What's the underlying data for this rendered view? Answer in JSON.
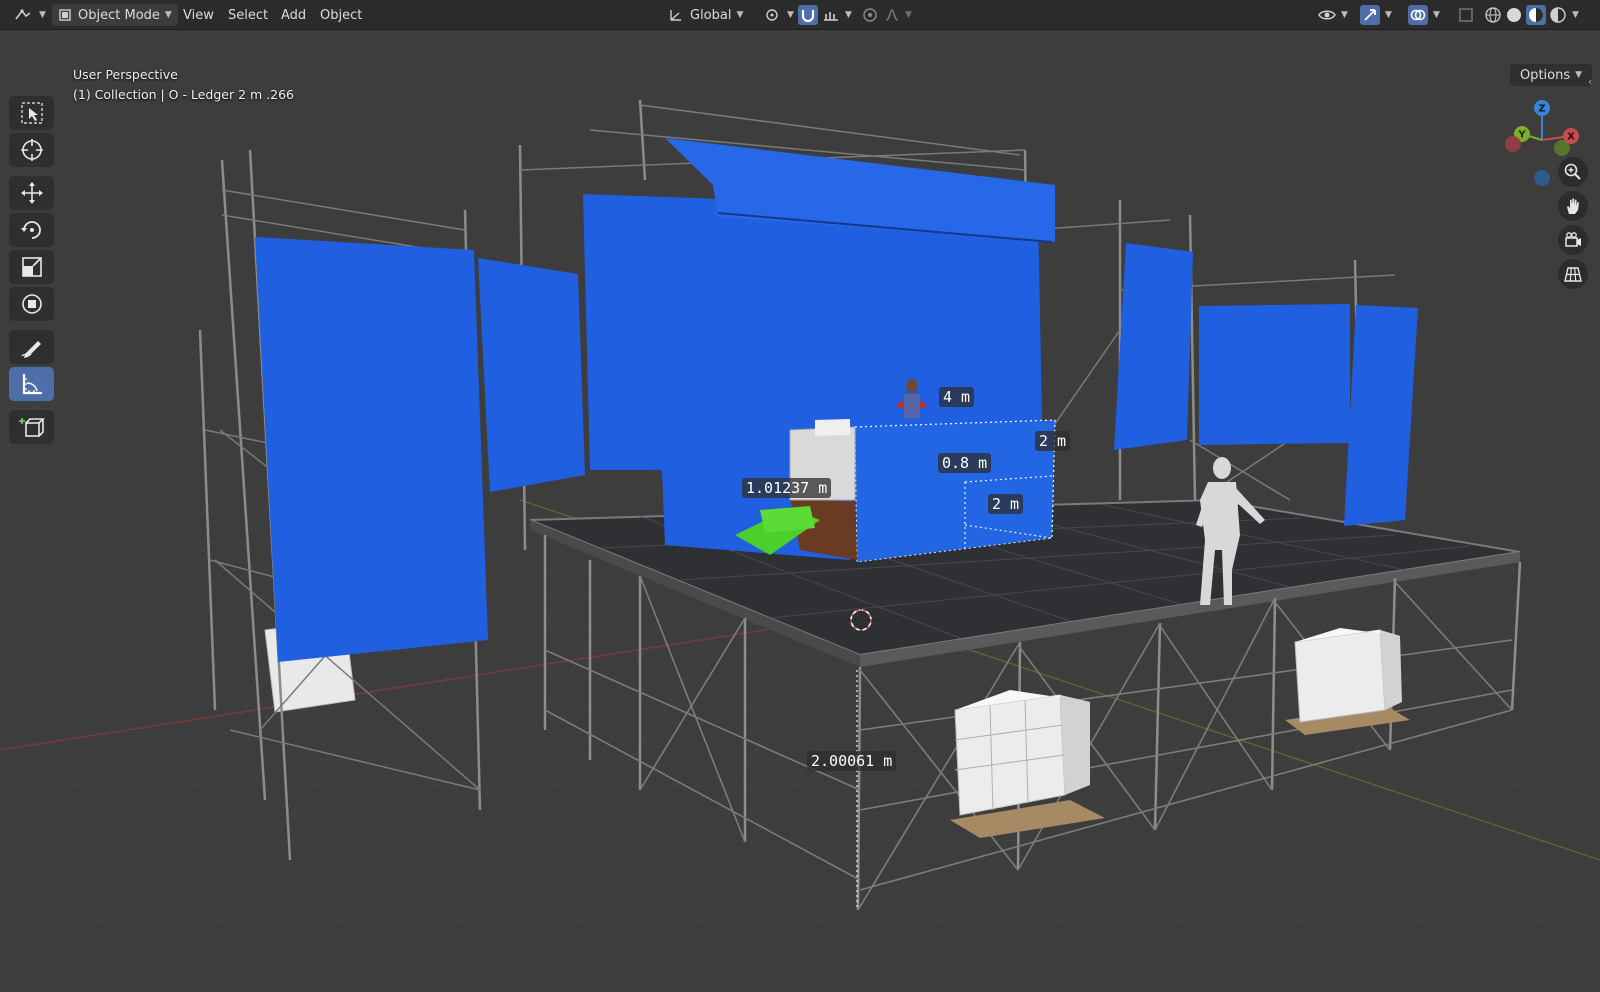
{
  "header": {
    "mode_label": "Object Mode",
    "menus": [
      "View",
      "Select",
      "Add",
      "Object"
    ],
    "orientation_label": "Global",
    "options_label": "Options"
  },
  "viewport": {
    "view_name": "User Perspective",
    "active_object": "(1) Collection | O - Ledger 2 m .266"
  },
  "measurements": {
    "width_top": "4 m",
    "depth_right": "2 m",
    "height_mid": "0.8 m",
    "depth_bottom": "2 m",
    "stairs": "1.01237 m",
    "deck_height": "2.00061 m"
  },
  "gizmo": {
    "z": "Z",
    "y": "Y",
    "x": "X"
  },
  "colors": {
    "header_bg": "#2b2b2b",
    "viewport_bg": "#3d3d3d",
    "banner_blue": "#1f5fe0",
    "active_tool": "#4d6ea8",
    "axis_x": "#c84a52",
    "axis_y": "#7fae2c",
    "axis_z": "#3a85d6"
  },
  "icons": {
    "toolbar": [
      "select-box-icon",
      "cursor-icon",
      "move-icon",
      "rotate-icon",
      "scale-icon",
      "transform-icon",
      "annotate-icon",
      "measure-icon",
      "add-cube-icon"
    ],
    "navigation": [
      "zoom-icon",
      "pan-hand-icon",
      "camera-icon",
      "grid-view-icon"
    ]
  }
}
